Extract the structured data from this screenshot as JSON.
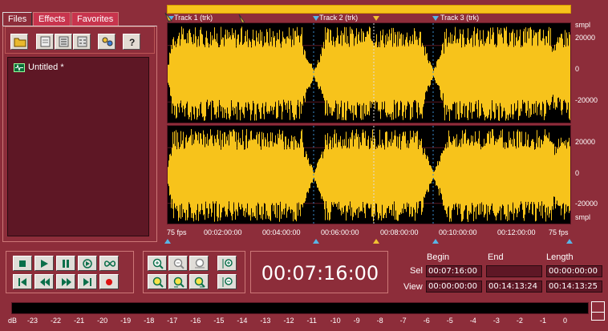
{
  "left_panel": {
    "tabs": [
      {
        "label": "Files",
        "active": true
      },
      {
        "label": "Effects",
        "active": false
      },
      {
        "label": "Favorites",
        "active": false
      }
    ],
    "toolbar_icons": [
      "open-folder-icon",
      "new-file-icon",
      "properties-icon",
      "align-icon",
      "effects-chain-icon",
      "help-icon"
    ],
    "files": [
      {
        "name": "Untitled *",
        "icon": "waveform-file-icon"
      }
    ]
  },
  "waveform": {
    "markers": [
      {
        "label": "Track 1 (trk)"
      },
      {
        "label": "Track 2 (trk)"
      },
      {
        "label": "Track 3 (trk)"
      }
    ],
    "scale_unit": "smpl",
    "scale_values": [
      "20000",
      "0",
      "-20000"
    ],
    "timeline": {
      "fps_left": "75 fps",
      "fps_right": "75 fps",
      "ticks": [
        "00:02:00:00",
        "00:04:00:00",
        "00:06:00:00",
        "00:08:00:00",
        "00:10:00:00",
        "00:12:00:00"
      ]
    },
    "colors": {
      "wave": "#f7c31b",
      "background": "#000000",
      "overview": "#f7c31b"
    }
  },
  "transport": {
    "buttons_row1": [
      "stop-icon",
      "play-icon",
      "pause-icon",
      "play-to-end-icon",
      "loop-icon"
    ],
    "buttons_row2": [
      "go-to-start-icon",
      "rewind-icon",
      "fast-forward-icon",
      "go-to-end-icon",
      "record-icon"
    ]
  },
  "zoom": {
    "buttons_row1": [
      "zoom-in-icon",
      "zoom-out-icon",
      "zoom-full-icon",
      "zoom-in-vertical-icon"
    ],
    "buttons_row2": [
      "zoom-selection-icon",
      "zoom-left-icon",
      "zoom-right-icon",
      "zoom-out-vertical-icon"
    ]
  },
  "time_display": {
    "value": "00:07:16:00"
  },
  "selection": {
    "headers": {
      "begin": "Begin",
      "end": "End",
      "length": "Length"
    },
    "sel": {
      "label": "Sel",
      "begin": "00:07:16:00",
      "end": "",
      "length": "00:00:00:00"
    },
    "view": {
      "label": "View",
      "begin": "00:00:00:00",
      "end": "00:14:13:24",
      "length": "00:14:13:25"
    }
  },
  "meter": {
    "unit": "dB",
    "labels": [
      "-23",
      "-22",
      "-21",
      "-20",
      "-19",
      "-18",
      "-17",
      "-16",
      "-15",
      "-14",
      "-13",
      "-12",
      "-11",
      "-10",
      "-9",
      "-8",
      "-7",
      "-6",
      "-5",
      "-4",
      "-3",
      "-2",
      "-1",
      "0"
    ]
  }
}
